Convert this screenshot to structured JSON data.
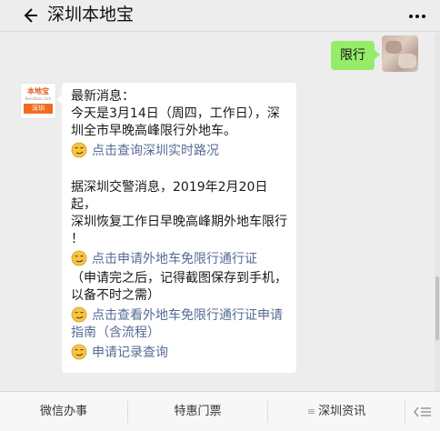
{
  "header": {
    "title": "深圳本地宝",
    "back_icon": "back-arrow-icon",
    "more_icon": "more-dots-icon"
  },
  "outgoing": {
    "text": "限行"
  },
  "official_account": {
    "logo_text": "本地宝",
    "logo_sub": "Bendibao.com",
    "logo_band": "深圳"
  },
  "incoming": {
    "line1": "最新消息：",
    "line2": "今天是3月14日（周四，工作日），深",
    "line3": "圳全市早晚高峰限行外地车。",
    "link1": "点击查询深圳实时路况",
    "para2_line1": "据深圳交警消息，2019年2月20日起，",
    "para2_line2": "深圳恢复工作日早晚高峰期外地车限行",
    "para2_line3": "！",
    "link2": "点击申请外地车免限行通行证",
    "note_line1": "（申请完之后，记得截图保存到手机，",
    "note_line2": "以备不时之需）",
    "link3_line1": "点击查看外地车免限行通行证申请",
    "link3_line2": "指南（含流程）",
    "link4": "申请记录查询"
  },
  "bottom_menu": {
    "item1": "微信办事",
    "item2": "特惠门票",
    "item3_mark": "≡",
    "item3": "深圳资讯",
    "keyboard_icon": "keyboard-switch-icon"
  },
  "colors": {
    "outgoing_bubble": "#95ec69",
    "link": "#576b95",
    "brand_orange": "#ef6c22"
  }
}
